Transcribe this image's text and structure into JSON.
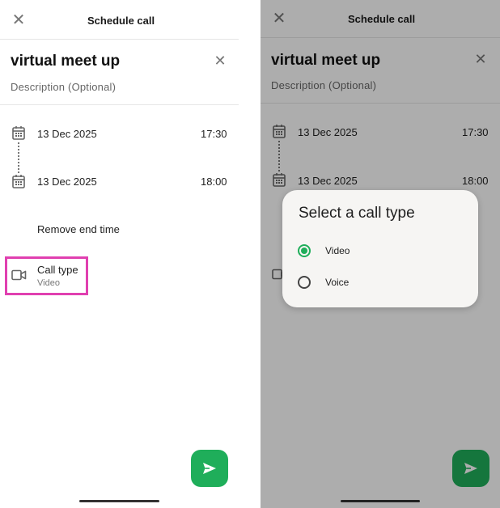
{
  "screens": [
    {
      "header": {
        "title": "Schedule call"
      },
      "meeting": {
        "title": "virtual meet up",
        "description_placeholder": "Description (Optional)"
      },
      "start": {
        "date": "13 Dec 2025",
        "time": "17:30"
      },
      "end": {
        "date": "13 Dec 2025",
        "time": "18:00"
      },
      "remove_end_label": "Remove end time",
      "call_type": {
        "label": "Call type",
        "value": "Video"
      }
    },
    {
      "header": {
        "title": "Schedule call"
      },
      "meeting": {
        "title": "virtual meet up",
        "description_placeholder": "Description (Optional)"
      },
      "start": {
        "date": "13 Dec 2025",
        "time": "17:30"
      },
      "end": {
        "date": "13 Dec 2025",
        "time": "18:00"
      },
      "dialog": {
        "title": "Select a call type",
        "options": [
          {
            "label": "Video",
            "selected": true
          },
          {
            "label": "Voice",
            "selected": false
          }
        ]
      }
    }
  ],
  "colors": {
    "accent": "#1fae5a",
    "highlight": "#e040b0"
  }
}
